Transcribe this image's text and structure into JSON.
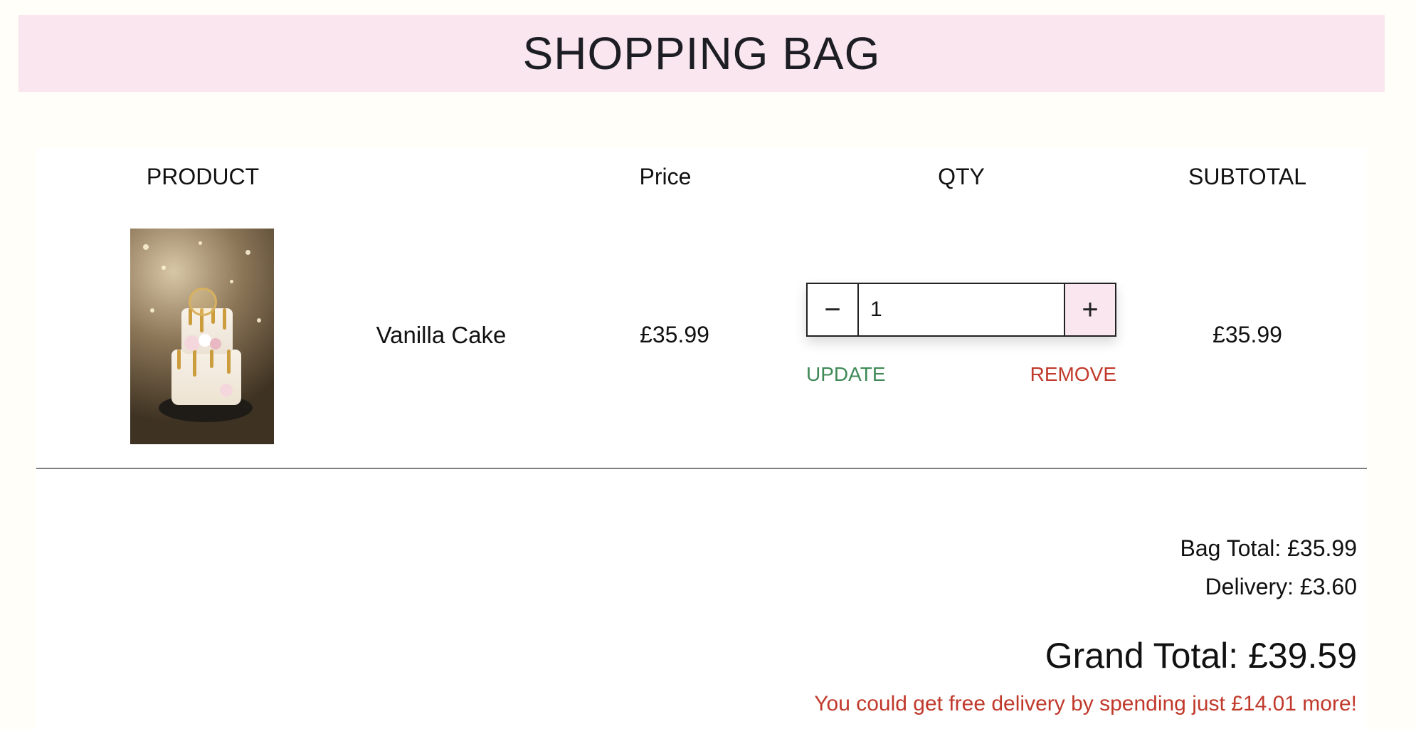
{
  "header": {
    "title": "SHOPPING BAG"
  },
  "table": {
    "columns": {
      "product": "PRODUCT",
      "price": "Price",
      "qty": "QTY",
      "subtotal": "SUBTOTAL"
    },
    "items": [
      {
        "name": "Vanilla Cake",
        "price": "£35.99",
        "quantity": "1",
        "subtotal": "£35.99",
        "actions": {
          "update": "UPDATE",
          "remove": "REMOVE"
        }
      }
    ]
  },
  "summary": {
    "bag_total": "Bag Total: £35.99",
    "delivery": "Delivery: £3.60",
    "grand_total": "Grand Total: £39.59",
    "free_delivery_notice": "You could get free delivery by spending just £14.01 more!"
  },
  "icons": {
    "decrement": "minus-icon",
    "increment": "plus-icon"
  },
  "colors": {
    "banner": "#f9e6ef",
    "update": "#3f8a57",
    "remove": "#c0392b",
    "notice": "#c0392b"
  }
}
